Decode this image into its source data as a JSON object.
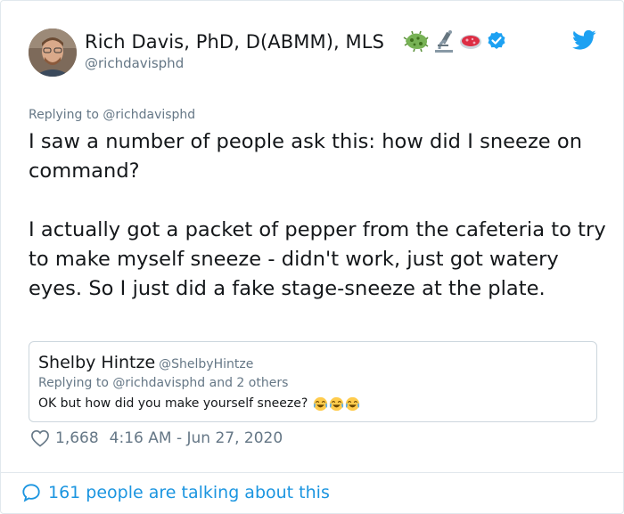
{
  "author": {
    "display_name": "Rich Davis, PhD, D(ABMM), MLS",
    "handle": "@richdavisphd",
    "name_emojis": [
      "microbe-emoji",
      "microscope-emoji",
      "petri-dish-emoji"
    ],
    "verified_icon": "verified-badge-icon"
  },
  "tweet": {
    "reply_prefix": "Replying to ",
    "reply_to": "@richdavisphd",
    "paragraph_1": "I saw a number of people ask this: how did I sneeze on command?",
    "paragraph_2": "I actually got a packet of pepper from the cafeteria to try to make myself sneeze - didn't work, just got watery eyes. So I just did a fake stage-sneeze at the plate."
  },
  "quoted_tweet": {
    "display_name": "Shelby Hintze",
    "handle": "@ShelbyHintze",
    "reply_context": "Replying to @richdavisphd and 2 others",
    "text": "OK but how did you make yourself sneeze?",
    "emojis": [
      "laughing-tears-emoji",
      "laughing-tears-emoji",
      "laughing-tears-emoji"
    ]
  },
  "meta": {
    "likes": "1,668",
    "timestamp": "4:16 AM - Jun 27, 2020"
  },
  "footer": {
    "talking": "161 people are talking about this"
  },
  "colors": {
    "link_blue": "#1b95e0",
    "twitter_blue": "#1da1f2",
    "secondary_gray": "#657786",
    "border": "#e1e8ed"
  }
}
